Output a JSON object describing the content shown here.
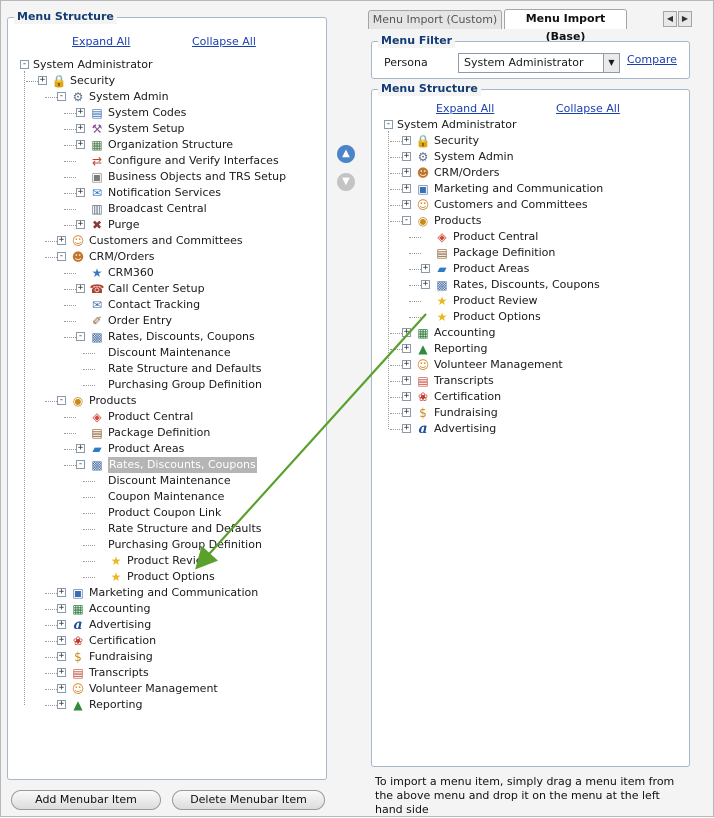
{
  "left": {
    "title": "Menu Structure",
    "expand_all": "Expand All",
    "collapse_all": "Collapse All",
    "root_label": "System Administrator",
    "tree": [
      {
        "label": "Security",
        "icon": "lock-icon",
        "exp": "+"
      },
      {
        "label": "System Admin",
        "icon": "gear-icon",
        "exp": "-"
      },
      {
        "label": "System Codes",
        "icon": "codes-icon",
        "exp": "+"
      },
      {
        "label": "System Setup",
        "icon": "setup-icon",
        "exp": "+"
      },
      {
        "label": "Organization Structure",
        "icon": "org-icon",
        "exp": "+"
      },
      {
        "label": "Configure and Verify Interfaces",
        "icon": "interfaces-icon",
        "exp": ""
      },
      {
        "label": "Business Objects and TRS Setup",
        "icon": "document-icon",
        "exp": ""
      },
      {
        "label": "Notification Services",
        "icon": "notification-icon",
        "exp": "+"
      },
      {
        "label": "Broadcast Central",
        "icon": "broadcast-icon",
        "exp": ""
      },
      {
        "label": "Purge",
        "icon": "purge-icon",
        "exp": "+"
      },
      {
        "label": "Customers and Committees",
        "icon": "people-icon",
        "exp": "+"
      },
      {
        "label": "CRM/Orders",
        "icon": "person-icon",
        "exp": "-"
      },
      {
        "label": "CRM360",
        "icon": "crm-icon",
        "exp": ""
      },
      {
        "label": "Call Center Setup",
        "icon": "call-center-icon",
        "exp": "+"
      },
      {
        "label": "Contact Tracking",
        "icon": "contact-icon",
        "exp": ""
      },
      {
        "label": "Order Entry",
        "icon": "order-icon",
        "exp": ""
      },
      {
        "label": "Rates, Discounts, Coupons",
        "icon": "rates-icon",
        "exp": "-"
      },
      {
        "label": "Discount Maintenance",
        "icon": "",
        "exp": ""
      },
      {
        "label": "Rate Structure and Defaults",
        "icon": "",
        "exp": ""
      },
      {
        "label": "Purchasing Group Definition",
        "icon": "",
        "exp": ""
      },
      {
        "label": "Products",
        "icon": "products-icon",
        "exp": "-"
      },
      {
        "label": "Product Central",
        "icon": "product-central-icon",
        "exp": ""
      },
      {
        "label": "Package Definition",
        "icon": "package-icon",
        "exp": ""
      },
      {
        "label": "Product Areas",
        "icon": "product-areas-icon",
        "exp": "+"
      },
      {
        "label": "Rates, Discounts, Coupons",
        "icon": "rates-icon",
        "exp": "-"
      },
      {
        "label": "Discount Maintenance",
        "icon": "",
        "exp": ""
      },
      {
        "label": "Coupon Maintenance",
        "icon": "",
        "exp": ""
      },
      {
        "label": "Product Coupon Link",
        "icon": "",
        "exp": ""
      },
      {
        "label": "Rate Structure and Defaults",
        "icon": "",
        "exp": ""
      },
      {
        "label": "Purchasing Group Definition",
        "icon": "",
        "exp": ""
      },
      {
        "label": "Product Review",
        "icon": "star-icon",
        "exp": ""
      },
      {
        "label": "Product Options",
        "icon": "star-icon",
        "exp": ""
      },
      {
        "label": "Marketing and Communication",
        "icon": "marketing-icon",
        "exp": "+"
      },
      {
        "label": "Accounting",
        "icon": "accounting-icon",
        "exp": "+"
      },
      {
        "label": "Advertising",
        "icon": "advertising-icon",
        "exp": "+"
      },
      {
        "label": "Certification",
        "icon": "certification-icon",
        "exp": "+"
      },
      {
        "label": "Fundraising",
        "icon": "fundraising-icon",
        "exp": "+"
      },
      {
        "label": "Transcripts",
        "icon": "transcripts-icon",
        "exp": "+"
      },
      {
        "label": "Volunteer Management",
        "icon": "volunteer-icon",
        "exp": "+"
      },
      {
        "label": "Reporting",
        "icon": "reporting-icon",
        "exp": "+"
      }
    ]
  },
  "right": {
    "tabs": [
      "Menu Import (Custom)",
      "Menu Import (Base)"
    ],
    "active_tab": "Menu Import (Base)",
    "filter_title": "Menu Filter",
    "persona_label": "Persona",
    "persona_value": "System Administrator",
    "compare_label": "Compare",
    "structure_title": "Menu Structure",
    "expand_all": "Expand All",
    "collapse_all": "Collapse All",
    "root_label": "System Administrator",
    "tree": [
      {
        "label": "Security",
        "icon": "lock-icon",
        "exp": "+"
      },
      {
        "label": "System Admin",
        "icon": "gear-icon",
        "exp": "+"
      },
      {
        "label": "CRM/Orders",
        "icon": "person-icon",
        "exp": "+"
      },
      {
        "label": "Marketing and Communication",
        "icon": "marketing-icon",
        "exp": "+"
      },
      {
        "label": "Customers and Committees",
        "icon": "people-icon",
        "exp": "+"
      },
      {
        "label": "Products",
        "icon": "products-icon",
        "exp": "-"
      },
      {
        "label": "Product Central",
        "icon": "product-central-icon",
        "exp": ""
      },
      {
        "label": "Package Definition",
        "icon": "package-icon",
        "exp": ""
      },
      {
        "label": "Product Areas",
        "icon": "product-areas-icon",
        "exp": "+"
      },
      {
        "label": "Rates, Discounts, Coupons",
        "icon": "rates-icon",
        "exp": "+"
      },
      {
        "label": "Product Review",
        "icon": "star-icon",
        "exp": ""
      },
      {
        "label": "Product Options",
        "icon": "star-icon",
        "exp": ""
      },
      {
        "label": "Accounting",
        "icon": "accounting-icon",
        "exp": "+"
      },
      {
        "label": "Reporting",
        "icon": "reporting-icon",
        "exp": "+"
      },
      {
        "label": "Volunteer Management",
        "icon": "volunteer-icon",
        "exp": "+"
      },
      {
        "label": "Transcripts",
        "icon": "transcripts-icon",
        "exp": "+"
      },
      {
        "label": "Certification",
        "icon": "certification-icon",
        "exp": "+"
      },
      {
        "label": "Fundraising",
        "icon": "fundraising-icon",
        "exp": "+"
      },
      {
        "label": "Advertising",
        "icon": "advertising-icon",
        "exp": "+"
      }
    ],
    "help_text": "To import a menu item, simply drag a menu item from the above menu and drop it on the menu at the left hand side"
  },
  "buttons": {
    "add": "Add Menubar Item",
    "delete": "Delete Menubar Item"
  },
  "move_up_icon": "chevron-up-icon",
  "move_down_icon": "chevron-down-icon",
  "colors": {
    "accent": "#123c73",
    "link": "#1a3fb0",
    "drag_arrow": "#5aa02c",
    "selection": "#b5b5b5"
  }
}
